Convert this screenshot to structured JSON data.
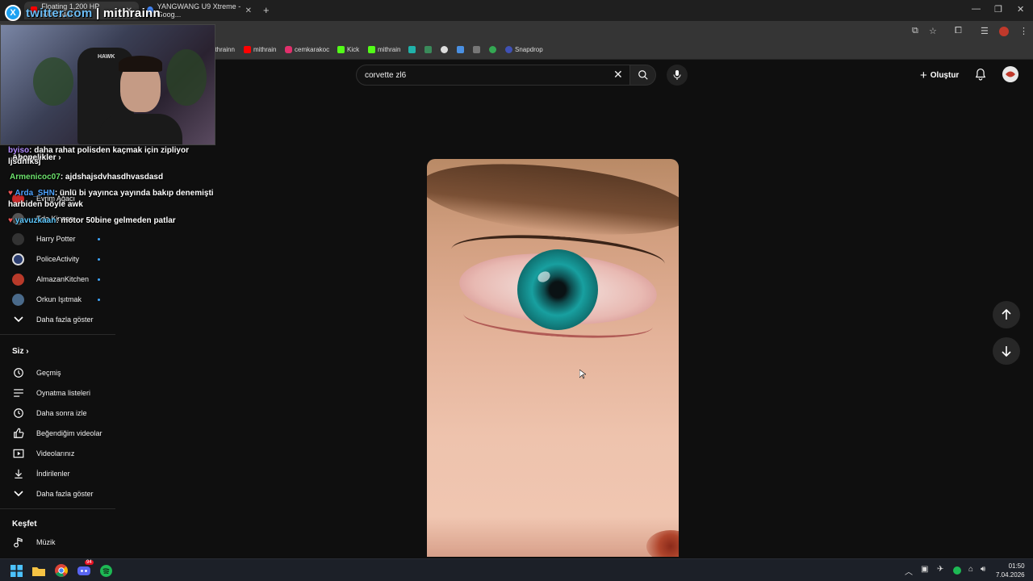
{
  "browser": {
    "tabs": [
      {
        "label": "Floating 1,200 HP YANGWA..."
      },
      {
        "label": "YANGWANG U9 Xtreme - Goog..."
      }
    ],
    "new_tab": "+",
    "close": "✕",
    "bookmarks": [
      {
        "label": "mithrainn",
        "color": "#9146ff"
      },
      {
        "label": "mithrain",
        "color": "#ff0000"
      },
      {
        "label": "cemkarakoc",
        "color": "#e1306c"
      },
      {
        "label": "Kick",
        "color": "#53fc18"
      },
      {
        "label": "mithrain",
        "color": "#53fc18"
      },
      {
        "label": "Snapdrop",
        "color": "#3f51b5"
      }
    ]
  },
  "overlay": {
    "badge": "X",
    "handle_prefix": "twitter.com",
    "handle_sep": " | ",
    "handle": "mithrainn",
    "webcam_brand": "HAWK"
  },
  "chat": [
    {
      "user": "byiso",
      "text": ": daha rahat polisden kaçmak için zipliyor ljsdnfksj",
      "color": "#b38cff"
    },
    {
      "user": "Armenicoc07",
      "text": ": ajdshajsdvhasdhvasdasd",
      "color": "#6ee36e"
    },
    {
      "user": "Arda_SHN",
      "text": ": ünlü bi yayınca yayında bakıp denemişti harbiden böyle awk",
      "color": "#4da3ff"
    },
    {
      "user": "yavuzkaan",
      "text": ": motor 50bine gelmeden patlar",
      "color": "#5ec9ff"
    }
  ],
  "youtube": {
    "search_value": "corvette zl6",
    "create_label": "Oluştur",
    "sidebar": {
      "subscriptions_header": "Abonelikler",
      "subscriptions": [
        {
          "label": "Evrim Ağacı",
          "color": "#c62828"
        },
        {
          "label": "Eda Kinzen",
          "color": "#555"
        },
        {
          "label": "Harry Potter",
          "color": "#333"
        },
        {
          "label": "PoliceActivity",
          "color": "#2c3e70"
        },
        {
          "label": "AlmazanKitchen",
          "color": "#b83a2a"
        },
        {
          "label": "Orkun Işıtmak",
          "color": "#4a6a8a"
        }
      ],
      "show_more_1": "Daha fazla göster",
      "you_header": "Siz",
      "you_items": [
        {
          "label": "Geçmiş",
          "icon": "history-icon"
        },
        {
          "label": "Oynatma listeleri",
          "icon": "playlist-icon"
        },
        {
          "label": "Daha sonra izle",
          "icon": "clock-icon"
        },
        {
          "label": "Beğendiğim videolar",
          "icon": "thumbs-up-icon"
        },
        {
          "label": "Videolarınız",
          "icon": "video-icon"
        },
        {
          "label": "İndirilenler",
          "icon": "download-icon"
        }
      ],
      "show_more_2": "Daha fazla göster",
      "explore_header": "Keşfet",
      "explore_items": [
        {
          "label": "Müzik",
          "icon": "music-icon"
        }
      ]
    }
  },
  "taskbar": {
    "time": "01:50",
    "date": "7.04.2026",
    "discord_badge": "94"
  }
}
